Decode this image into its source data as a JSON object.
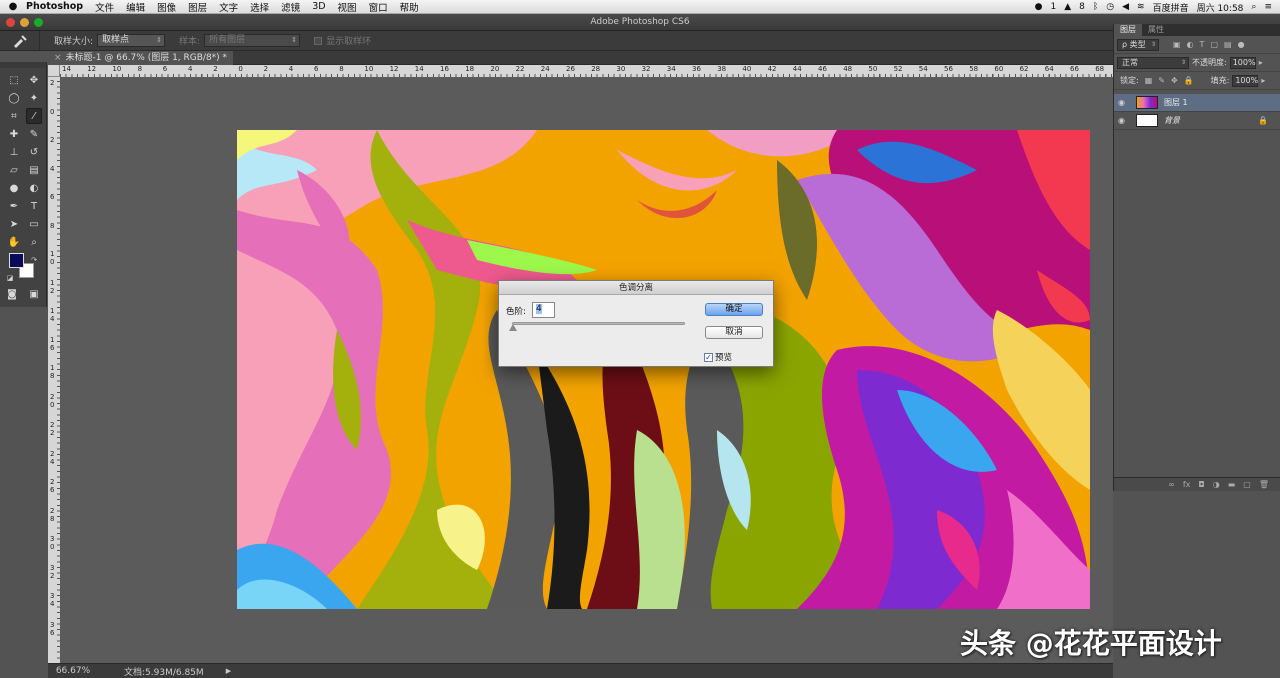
{
  "menubar": {
    "app_name": "Photoshop",
    "items": [
      "文件",
      "编辑",
      "图像",
      "图层",
      "文字",
      "选择",
      "滤镜",
      "3D",
      "视图",
      "窗口",
      "帮助"
    ],
    "status": {
      "qq_count": "1",
      "tray_count": "8",
      "ime": "百度拼音",
      "clock": "周六 10:58"
    }
  },
  "window": {
    "title": "Adobe Photoshop CS6"
  },
  "options_bar": {
    "sample_size_label": "取样大小:",
    "sample_size_value": "取样点",
    "sample_label": "样本:",
    "sample_value": "所有图层",
    "show_ring_label": "显示取样环"
  },
  "document": {
    "tab_close": "×",
    "tab_title": "未标题-1 @ 66.7% (图层 1, RGB/8*) *",
    "hruler_ticks": [
      "14",
      "12",
      "10",
      "8",
      "6",
      "4",
      "2",
      "0",
      "2",
      "4",
      "6",
      "8",
      "10",
      "12",
      "14",
      "16",
      "18",
      "20",
      "22",
      "24",
      "26",
      "28",
      "30",
      "32",
      "34",
      "36",
      "38",
      "40",
      "42",
      "44",
      "46",
      "48",
      "50",
      "52",
      "54",
      "56",
      "58",
      "60",
      "62",
      "64",
      "66",
      "68"
    ],
    "vruler_ticks": [
      "2",
      "0",
      "2",
      "4",
      "6",
      "8",
      "1 0",
      "1 2",
      "1 4",
      "1 6",
      "1 8",
      "2 0",
      "2 2",
      "2 4",
      "2 6",
      "2 8",
      "3 0",
      "3 2",
      "3 4",
      "3 6"
    ]
  },
  "status_bar": {
    "zoom": "66.67%",
    "doc_size": "文档:5.93M/6.85M",
    "arrow": "▶"
  },
  "layers_panel": {
    "tabs": [
      "图层",
      "属性"
    ],
    "filter_label": "ρ 类型",
    "blend_mode": "正常",
    "opacity_label": "不透明度:",
    "opacity_value": "100%",
    "lock_label": "锁定:",
    "fill_label": "填充:",
    "fill_value": "100%",
    "layers": [
      {
        "name": "图层 1",
        "selected": true
      },
      {
        "name": "背景",
        "selected": false,
        "locked": true
      }
    ],
    "footer_icons": [
      "link-icon",
      "fx-icon",
      "mask-icon",
      "adjustment-icon",
      "group-icon",
      "new-layer-icon",
      "trash-icon"
    ]
  },
  "dialog": {
    "title": "色调分离",
    "levels_label": "色阶:",
    "levels_value": "4",
    "ok_label": "确定",
    "cancel_label": "取消",
    "preview_label": "预览",
    "preview_checked": true,
    "slider_level": 0.0
  },
  "watermark": "头条 @花花平面设计",
  "colors": {
    "foreground": "#0c0b5a",
    "background": "#ffffff",
    "accent": "#6aa5ee"
  }
}
